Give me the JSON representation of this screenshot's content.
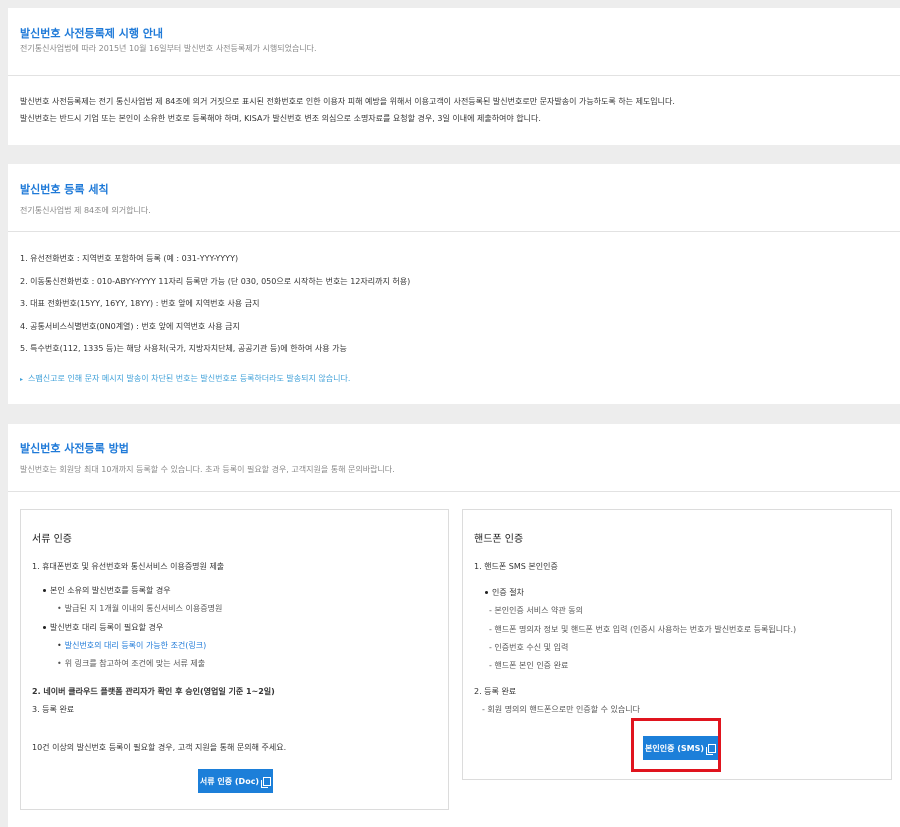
{
  "sec1": {
    "title": "발신번호 사전등록제 시행 안내",
    "subtitle": "전기통신사업법에 따라 2015년 10월 16일부터 발신번호 사전등록제가 시행되었습니다.",
    "line1": "발신번호 사전등록제는 전기 통신사업법 제 84조에 의거 거짓으로 표시된 전화번호로 인한 이용자 피해 예방을 위해서 이용고객이 사전등록된 발신번호로만 문자발송이 가능하도록 하는 제도입니다.",
    "line2": "발신번호는 반드시 기업 또는 본인이 소유한 번호로 등록해야 하며, KISA가 발신번호 변조 의심으로 소명자료를 요청할 경우, 3일 이내에 제출하여야 합니다."
  },
  "sec2": {
    "title": "발신번호 등록 세칙",
    "subtitle": "전기통신사업법 제 84조에 의거합니다.",
    "rules": [
      "1. 유선전화번호 : 지역번호 포함하여 등록 (예 : 031-YYY-YYYY)",
      "2. 이동통신전화번호 : 010-ABYY-YYYY 11자리 등록만 가능 (단 030, 050으로 시작하는 번호는 12자리까지 허용)",
      "3. 대표 전화번호(15YY, 16YY, 18YY) : 번호 앞에 지역번호 사용 금지",
      "4. 공통서비스식별번호(0N0계열) : 번호 앞에 지역번호 사용 금지",
      "5. 특수번호(112, 1335 등)는 해당 사용처(국가, 지방자치단체, 공공기관 등)에 한하여 사용 가능"
    ],
    "note": "스팸신고로 인해 문자 메시지 발송이 차단된 번호는 발신번호로 등록하더라도 발송되지 않습니다."
  },
  "sec3": {
    "title": "발신번호 사전등록 방법",
    "subtitle": "발신번호는 회원당 최대 10개까지 등록할 수 있습니다. 초과 등록이 필요할 경우, 고객지원을 통해 문의바랍니다.",
    "doc": {
      "title": "서류 인증",
      "step1": "1. 휴대폰번호 및 유선번호와 통신서비스 이용증명원 제출",
      "own_title": "본인 소유의 발신번호를 등록할 경우",
      "own_item": "발급된 지 1개월 이내의 통신서비스 이용증명원",
      "proxy_title": "발신번호 대리 등록이 필요할 경우",
      "proxy_link": "발신번호의 대리 등록이 가능한 조건(링크)",
      "proxy_item": "위 링크를 참고하여 조건에 맞는 서류 제출",
      "step2": "2. 네이버 클라우드 플랫폼 관리자가 확인 후 승인(영업일 기준 1~2일)",
      "step3": "3. 등록 완료",
      "note": "10건 이상의 발신번호 등록이 필요할 경우, 고객 지원을 통해 문의해 주세요.",
      "button": "서류 인증 (Doc)"
    },
    "phone": {
      "title": "핸드폰 인증",
      "step1": "1. 핸드폰 SMS 본인인증",
      "proc_title": "인증 절차",
      "proc_items": [
        "- 본인인증 서비스 약관 동의",
        "- 핸드폰 명의자 정보 및 핸드폰 번호 입력 (인증시 사용하는 번호가 발신번호로 등록됩니다.)",
        "- 인증번호 수신 및 입력",
        "- 핸드폰 본인 인증 완료"
      ],
      "step2": "2. 등록 완료",
      "step2_note": "- 회원 명의의 핸드폰으로만 인증할 수 있습니다",
      "button": "본인인증 (SMS)"
    }
  },
  "colors": {
    "accent": "#1f7ad8",
    "button": "#1c7fd9",
    "highlight": "#e0141e"
  }
}
